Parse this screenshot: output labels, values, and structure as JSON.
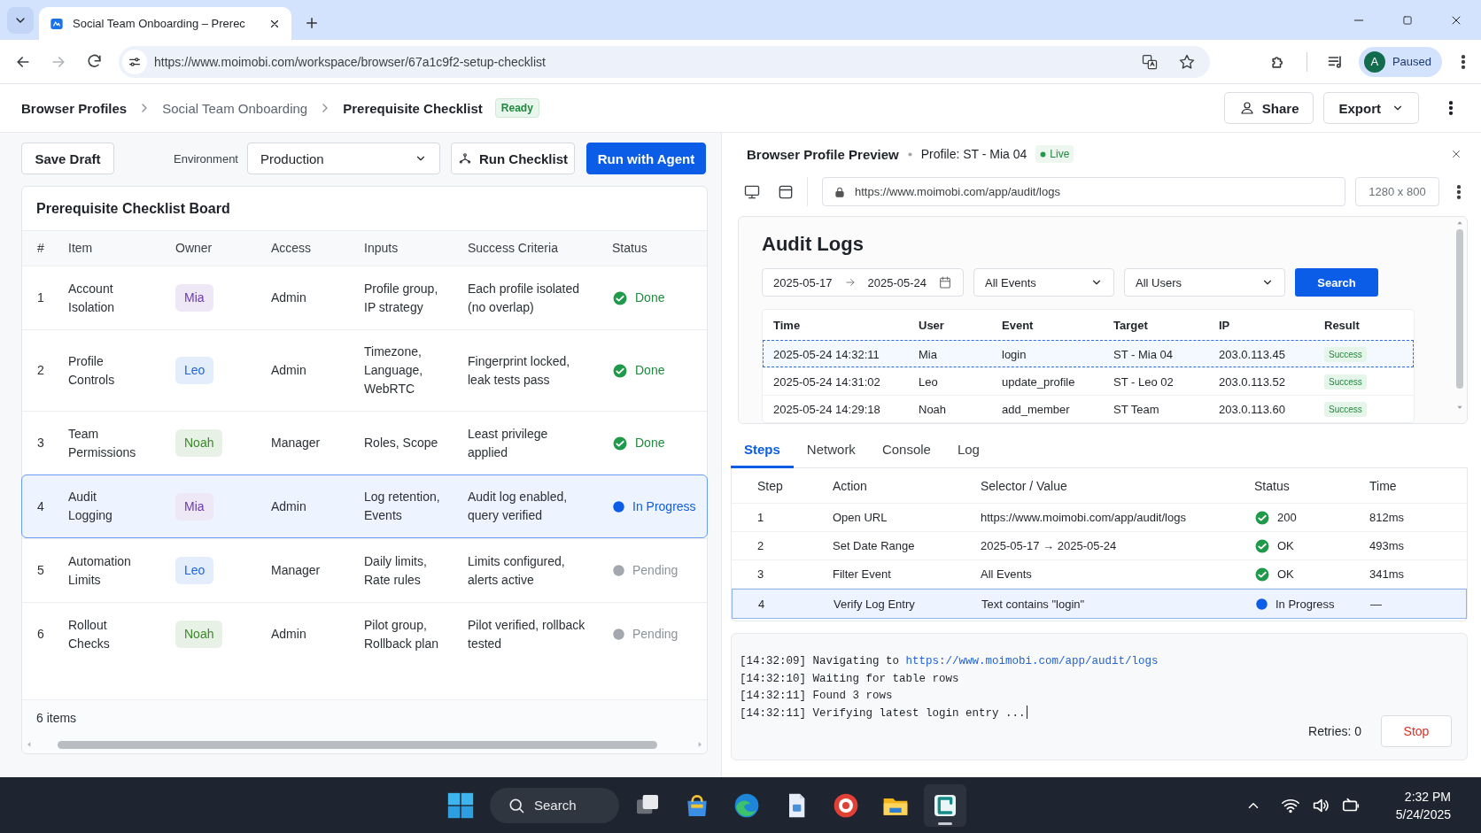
{
  "browser": {
    "tab_title": "Social Team Onboarding – Prerec",
    "url": "https://www.moimobi.com/workspace/browser/67a1c9f2-setup-checklist",
    "profile_initial": "A",
    "profile_status": "Paused"
  },
  "breadcrumb": [
    {
      "label": "Browser Profiles",
      "muted": false
    },
    {
      "label": "Social Team Onboarding",
      "muted": true
    },
    {
      "label": "Prerequisite Checklist",
      "muted": false
    }
  ],
  "page_status": "Ready",
  "header_actions": {
    "share": "Share",
    "export": "Export"
  },
  "toolbar": {
    "save": "Save Draft",
    "environment_label": "Environment",
    "environment": "Production",
    "run": "Run Checklist",
    "run_agent": "Run with Agent"
  },
  "checklist": {
    "title": "Prerequisite Checklist Board",
    "columns": [
      "#",
      "Item",
      "Owner",
      "Access",
      "Inputs",
      "Success Criteria",
      "Status"
    ],
    "rows": [
      {
        "num": "1",
        "item": "Account Isolation",
        "owner": "Mia",
        "color": "#6a3ab2",
        "access": "Admin",
        "inputs": "Profile group, IP strategy",
        "criteria": "Each profile isolated (no overlap)",
        "status": "Done",
        "kind": "done",
        "selected": false
      },
      {
        "num": "2",
        "item": "Profile Controls",
        "owner": "Leo",
        "color": "#1b66e0",
        "access": "Admin",
        "inputs": "Timezone, Language, WebRTC",
        "criteria": "Fingerprint locked, leak tests pass",
        "status": "Done",
        "kind": "done",
        "selected": false
      },
      {
        "num": "3",
        "item": "Team Permissions",
        "owner": "Noah",
        "color": "#3b8a2a",
        "access": "Manager",
        "inputs": "Roles, Scope",
        "criteria": "Least privilege applied",
        "status": "Done",
        "kind": "done",
        "selected": false
      },
      {
        "num": "4",
        "item": "Audit Logging",
        "owner": "Mia",
        "color": "#6a3ab2",
        "access": "Admin",
        "inputs": "Log retention, Events",
        "criteria": "Audit log enabled, query verified",
        "status": "In Progress",
        "kind": "progress",
        "selected": true
      },
      {
        "num": "5",
        "item": "Automation Limits",
        "owner": "Leo",
        "color": "#1b66e0",
        "access": "Manager",
        "inputs": "Daily limits, Rate rules",
        "criteria": "Limits configured, alerts active",
        "status": "Pending",
        "kind": "pending",
        "selected": false
      },
      {
        "num": "6",
        "item": "Rollout Checks",
        "owner": "Noah",
        "color": "#3b8a2a",
        "access": "Admin",
        "inputs": "Pilot group, Rollback plan",
        "criteria": "Pilot verified, rollback tested",
        "status": "Pending",
        "kind": "pending",
        "selected": false
      }
    ],
    "footer": "6 items"
  },
  "preview": {
    "title": "Browser Profile Preview",
    "profile": "Profile: ST - Mia 04",
    "live": "Live",
    "url": "https://www.moimobi.com/app/audit/logs",
    "viewport": "1280 x 800",
    "page": {
      "title": "Audit Logs",
      "date_from": "2025-05-17",
      "date_to": "2025-05-24",
      "event_filter": "All Events",
      "user_filter": "All Users",
      "search": "Search",
      "columns": [
        "Time",
        "User",
        "Event",
        "Target",
        "IP",
        "Result"
      ],
      "rows": [
        {
          "time": "2025-05-24 14:32:11",
          "user": "Mia",
          "event": "login",
          "target": "ST - Mia 04",
          "ip": "203.0.113.45",
          "result": "Success",
          "selected": true
        },
        {
          "time": "2025-05-24 14:31:02",
          "user": "Leo",
          "event": "update_profile",
          "target": "ST - Leo 02",
          "ip": "203.0.113.52",
          "result": "Success",
          "selected": false
        },
        {
          "time": "2025-05-24 14:29:18",
          "user": "Noah",
          "event": "add_member",
          "target": "ST Team",
          "ip": "203.0.113.60",
          "result": "Success",
          "selected": false
        }
      ]
    }
  },
  "tabs": [
    {
      "label": "Steps",
      "selected": true
    },
    {
      "label": "Network",
      "selected": false
    },
    {
      "label": "Console",
      "selected": false
    },
    {
      "label": "Log",
      "selected": false
    }
  ],
  "steps": {
    "columns": [
      "Step",
      "Action",
      "Selector / Value",
      "Status",
      "Time"
    ],
    "rows": [
      {
        "step": "1",
        "action": "Open URL",
        "value": "https://www.moimobi.com/app/audit/logs",
        "status": "200",
        "kind": "done",
        "time": "812ms",
        "selected": false
      },
      {
        "step": "2",
        "action": "Set Date Range",
        "value": "2025-05-17 → 2025-05-24",
        "status": "OK",
        "kind": "done",
        "time": "493ms",
        "selected": false
      },
      {
        "step": "3",
        "action": "Filter Event",
        "value": "All Events",
        "status": "OK",
        "kind": "done",
        "time": "341ms",
        "selected": false
      },
      {
        "step": "4",
        "action": "Verify Log Entry",
        "value": "Text contains \"login\"",
        "status": "In Progress",
        "kind": "progress",
        "time": "—",
        "selected": true
      }
    ]
  },
  "console": {
    "lines": [
      {
        "text": "[14:32:09] Navigating to",
        "link": "https://www.moimobi.com/app/audit/logs",
        "cursor": false
      },
      {
        "text": "[14:32:10] Waiting for table rows",
        "cursor": false
      },
      {
        "text": "[14:32:11] Found 3 rows",
        "cursor": false
      },
      {
        "text": "[14:32:11] Verifying latest login entry ...",
        "cursor": true
      }
    ],
    "retries": "Retries: 0",
    "stop": "Stop"
  },
  "taskbar": {
    "search": "Search",
    "apps": [
      {
        "kind": "task-view",
        "active": false
      },
      {
        "kind": "store",
        "active": false
      },
      {
        "kind": "edge",
        "active": false
      },
      {
        "kind": "document",
        "active": false
      },
      {
        "kind": "record",
        "active": false
      },
      {
        "kind": "folder",
        "active": false
      },
      {
        "kind": "app",
        "active": true
      }
    ],
    "time": "2:32 PM",
    "date": "5/24/2025"
  }
}
